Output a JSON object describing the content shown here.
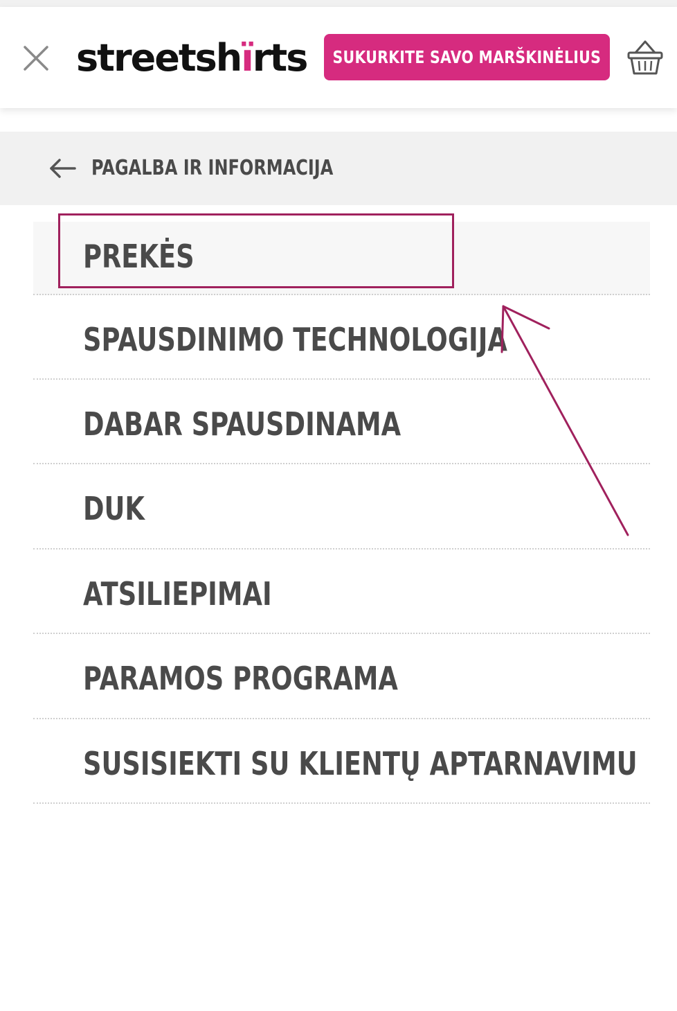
{
  "header": {
    "logo_text_a": "streetsh",
    "logo_text_b": "rts",
    "cta_label": "SUKURKITE SAVO MARŠKINĖLIUS",
    "close_icon": "close-icon",
    "basket_icon": "basket-icon"
  },
  "nav": {
    "back_label": "PAGALBA IR INFORMACIJA",
    "back_icon": "arrow-left-icon"
  },
  "menu": {
    "items": [
      {
        "label": "PREKĖS"
      },
      {
        "label": "SPAUSDINIMO TECHNOLOGIJA"
      },
      {
        "label": "DABAR SPAUSDINAMA"
      },
      {
        "label": "DUK"
      },
      {
        "label": "ATSILIEPIMAI"
      },
      {
        "label": "PARAMOS PROGRAMA"
      },
      {
        "label": "SUSISIEKTI SU KLIENTŲ APTARNAVIMU"
      }
    ]
  },
  "colors": {
    "brand": "#d62b7f",
    "annotation": "#a0215d",
    "text": "#4a4a4a",
    "bar_bg": "#f1f1f1"
  }
}
